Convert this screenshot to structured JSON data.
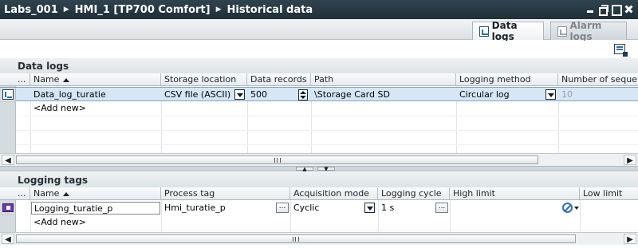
{
  "titlebar": {
    "breadcrumbs": [
      "Labs_001",
      "HMI_1 [TP700 Comfort]",
      "Historical data"
    ]
  },
  "tabs": [
    {
      "label": "Data logs",
      "active": true
    },
    {
      "label": "Alarm logs",
      "active": false
    }
  ],
  "data_logs": {
    "section_title": "Data logs",
    "columns": [
      "...",
      "Name",
      "Storage location",
      "Data records ...",
      "Path",
      "Logging method",
      "Number of seque..."
    ],
    "rows": [
      {
        "name": "Data_log_turatie",
        "storage_location": "CSV file (ASCII)",
        "data_records": "500",
        "path": "\\Storage Card SD",
        "logging_method": "Circular log",
        "number_of_sequences": "10"
      }
    ],
    "add_new": "<Add new>"
  },
  "logging_tags": {
    "section_title": "Logging tags",
    "columns": [
      "...",
      "Name",
      "Process tag",
      "Acquisition mode",
      "Logging cycle",
      "High limit",
      "Low limit"
    ],
    "rows": [
      {
        "name": "Logging_turatie_p",
        "process_tag": "Hmi_turatie_p",
        "acquisition_mode": "Cyclic",
        "logging_cycle": "1 s",
        "high_limit": "",
        "low_limit": ""
      }
    ],
    "add_new": "<Add new>"
  },
  "icons": {
    "data_log_row": "data-log-icon",
    "logging_tag_row": "logging-tag-icon",
    "export": "export-icon",
    "low_limit": "no-limit-icon"
  },
  "colors": {
    "titlebar": "#2f4350",
    "selected_row": "#d7e6f5",
    "tag_icon": "#6c3aa8",
    "limit_icon": "#2d6cc4"
  }
}
